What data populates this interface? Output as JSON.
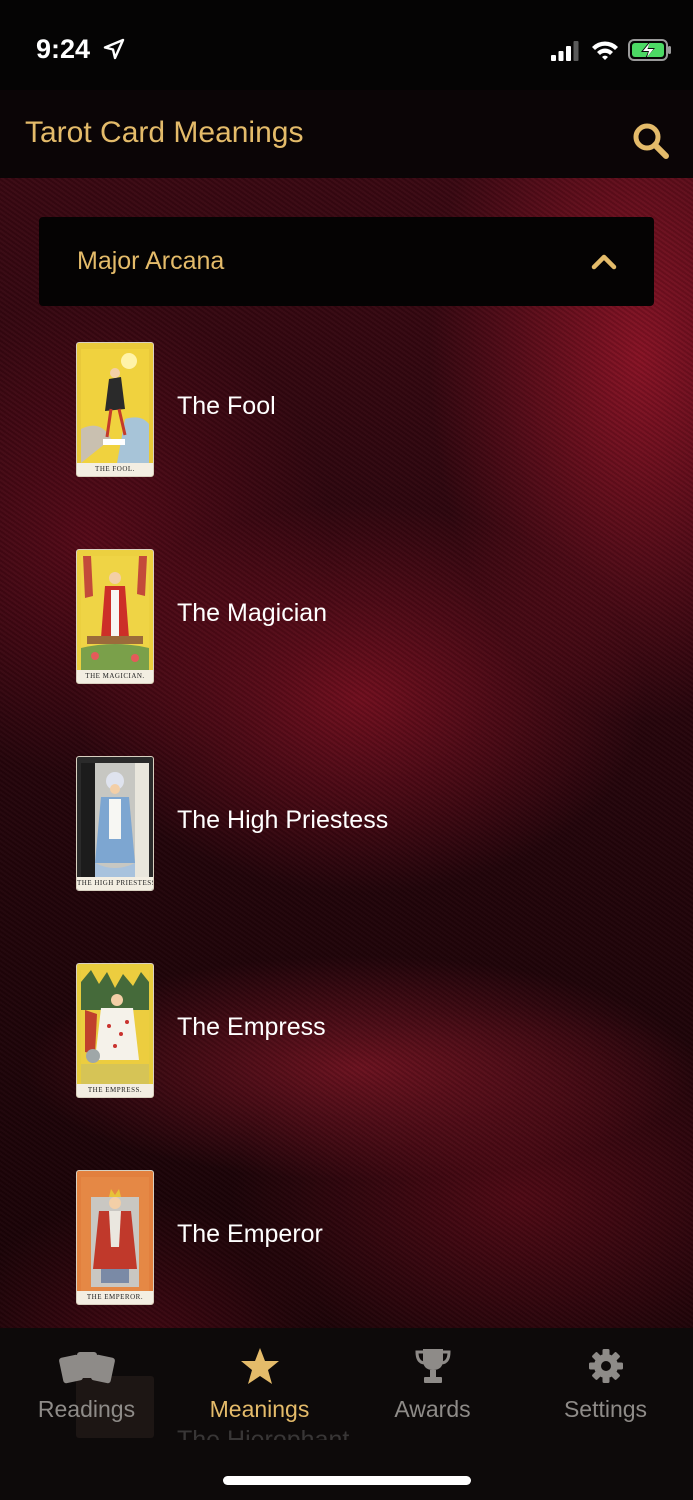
{
  "status_bar": {
    "time": "9:24"
  },
  "header": {
    "title": "Tarot Card Meanings",
    "search_icon": "search-icon"
  },
  "section": {
    "title": "Major Arcana",
    "expanded": true
  },
  "cards": [
    {
      "name": "The Fool",
      "caption": "THE FOOL."
    },
    {
      "name": "The Magician",
      "caption": "THE MAGICIAN."
    },
    {
      "name": "The High Priestess",
      "caption": "THE HIGH PRIESTESS"
    },
    {
      "name": "The Empress",
      "caption": "THE EMPRESS."
    },
    {
      "name": "The Emperor",
      "caption": "THE EMPEROR."
    },
    {
      "name": "The Hierophant"
    }
  ],
  "tabs": [
    {
      "label": "Readings",
      "icon": "cards-icon",
      "active": false
    },
    {
      "label": "Meanings",
      "icon": "star-icon",
      "active": true
    },
    {
      "label": "Awards",
      "icon": "trophy-icon",
      "active": false
    },
    {
      "label": "Settings",
      "icon": "gear-icon",
      "active": false
    }
  ],
  "colors": {
    "accent": "#e4bb6a",
    "inactive_tab": "#8e8b88",
    "background": "#2a0610"
  }
}
